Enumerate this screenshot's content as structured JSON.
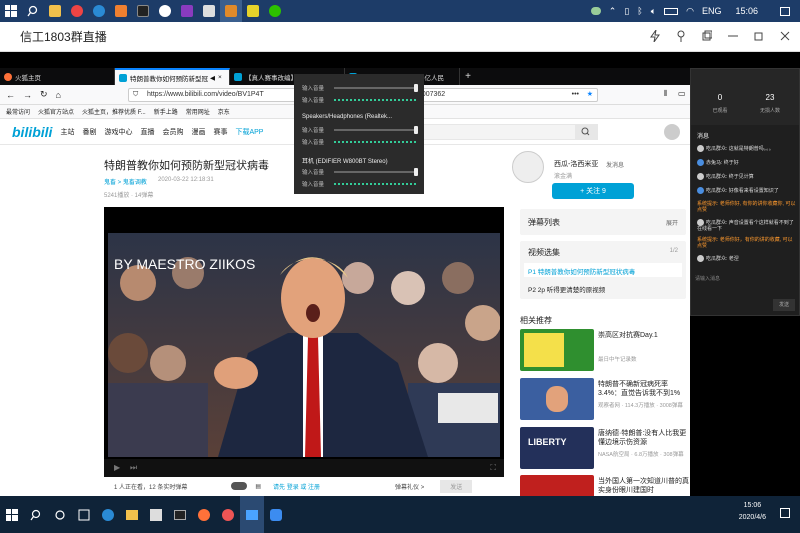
{
  "tray": {
    "language": "ENG",
    "time": "15:06"
  },
  "window": {
    "title": "信工1803群直播"
  },
  "browser": {
    "tabs": [
      {
        "label": "火狐主页"
      },
      {
        "label": "特朗普教你如何预防新型冠"
      },
      {
        "label": "【真人赛事改编】50时间高能"
      },
      {
        "label": "我是如此抱歉 | 一场14亿人民"
      }
    ],
    "url": "https://www.bilibili.com/video/BV1P4T",
    "url_tail": "119131007362",
    "bookmarks": [
      "最常访问",
      "火狐官方站点",
      "火狐主页，推荐优质 F...",
      "新手上路",
      "常用网址",
      "京东"
    ]
  },
  "bili": {
    "logo": "bilibili",
    "nav": [
      "主站",
      "番剧",
      "游戏中心",
      "直播",
      "会员购",
      "漫画",
      "赛事",
      "下载APP"
    ],
    "video_title": "特朗普教你如何预防新型冠状病毒",
    "breadcrumb": "鬼畜 > 鬼畜调教",
    "date": "2020-03-22 12:18:31",
    "views": "5241播放 · 14弹幕",
    "watermark": "BY MAESTRO ZIIKOS",
    "watching": "1 人正在看，12 条实时弹幕",
    "danmaku_hint": "请先 登录 或 注册",
    "danmaku_etiquette": "弹幕礼仪 >",
    "send": "发送",
    "uploader": "西瓜-洛西米亚",
    "message": "发消息",
    "uploader_desc": "滚金满",
    "follow": "+ 关注 9",
    "danmaku_list": "弹幕列表",
    "expand": "展开",
    "episodes_title": "视频选集",
    "episodes_count": "1/2",
    "episodes": [
      "P1  特朗普教你如何预防新型冠状病毒",
      "P2  2p 听得更清楚的原视频"
    ],
    "related_title": "相关推荐",
    "related": [
      {
        "title": "崇高区对抗赛Day.1",
        "stats": "最日中午记录数"
      },
      {
        "title": "特朗普不确新冠病死率3.4%：直觉告诉我不到1%",
        "stats": "观察者网 · 114.3万播放 · 3008弹幕"
      },
      {
        "title": "唐纳德·特朗普:没有人比我更懂边境示伤资源",
        "stats": "NASA航空局 · 6.8万播放 · 308弹幕"
      },
      {
        "title": "当外国人第一次知道川普的真实身份眼川建国时",
        "stats": ""
      }
    ]
  },
  "audio": {
    "rows_top": [
      "输入音量",
      "输入音量"
    ],
    "device1": "Speakers/Headphones (Realtek...",
    "device1_rows": [
      "输入音量",
      "输入音量"
    ],
    "device2": "耳机 (EDIFIER W800BT Stereo)",
    "device2_rows": [
      "输入音量",
      "输入音量"
    ]
  },
  "side": {
    "stat1": "0",
    "stat1_label": "已观看",
    "stat2": "23",
    "stat2_label": "无损人数",
    "chat_title": "消息",
    "messages": [
      {
        "text": "吃瓜群众: 这就是特朗普吗。。。",
        "orange": false
      },
      {
        "text": "赤兔马: 终于好",
        "orange": false
      },
      {
        "text": "吃瓜群众: 终于见计算",
        "orange": false
      },
      {
        "text": "吃瓜群众: 好像看来看设置知识了",
        "orange": false
      },
      {
        "text": "系统提示: 老师你好, 有你的讲你收藏你, 可以点赞",
        "orange": true
      },
      {
        "text": "吃瓜群众: 声音设置看个这样就看不到了在线看一下",
        "orange": false
      },
      {
        "text": "系统提示: 老师你好，有你的讲的收藏, 可以点赞",
        "orange": true
      },
      {
        "text": "吃瓜群众: 老涅",
        "orange": false
      }
    ],
    "input_placeholder": "请输入消息",
    "send": "发送"
  },
  "clock": {
    "time": "15:06",
    "date": "2020/4/6"
  }
}
